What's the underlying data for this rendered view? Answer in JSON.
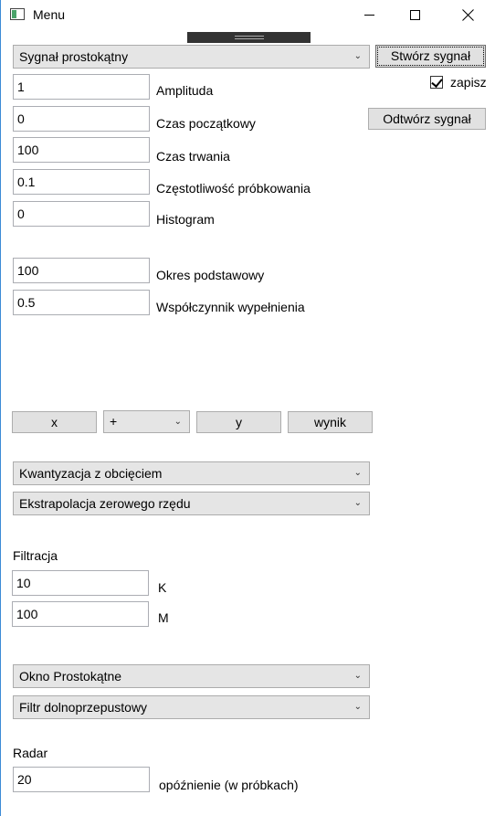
{
  "window": {
    "title": "Menu"
  },
  "signal": {
    "type_select": "Sygnał prostokątny",
    "create_button": "Stwórz sygnał",
    "save_checkbox_label": "zapisz",
    "save_checked": true,
    "replay_button": "Odtwórz sygnał"
  },
  "params": {
    "amplitude": {
      "value": "1",
      "label": "Amplituda"
    },
    "start_time": {
      "value": "0",
      "label": "Czas początkowy"
    },
    "duration": {
      "value": "100",
      "label": "Czas trwania"
    },
    "sampling_rate": {
      "value": "0.1",
      "label": "Częstotliwość próbkowania"
    },
    "histogram": {
      "value": "0",
      "label": "Histogram"
    },
    "base_period": {
      "value": "100",
      "label": "Okres podstawowy"
    },
    "duty_cycle": {
      "value": "0.5",
      "label": "Współczynnik wypełnienia"
    }
  },
  "operation": {
    "x_button": "x",
    "operator_select": "+",
    "y_button": "y",
    "result_button": "wynik"
  },
  "conversion": {
    "quantization_select": "Kwantyzacja z obcięciem",
    "extrapolation_select": "Ekstrapolacja zerowego rzędu"
  },
  "filtering": {
    "heading": "Filtracja",
    "k": {
      "value": "10",
      "label": "K"
    },
    "m": {
      "value": "100",
      "label": "M"
    },
    "window_select": "Okno Prostokątne",
    "filter_select": "Filtr dolnoprzepustowy"
  },
  "radar": {
    "heading": "Radar",
    "delay": {
      "value": "20",
      "label": "opóźnienie (w próbkach)"
    }
  },
  "colors": {
    "window_border": "#3c8bd6",
    "control_bg": "#e1e1e1",
    "checkbox_check": "#000000"
  }
}
